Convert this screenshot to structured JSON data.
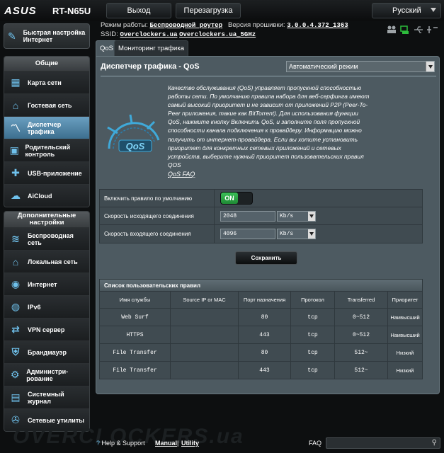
{
  "header": {
    "brand": "ASUS",
    "model": "RT-N65U",
    "logout": "Выход",
    "reboot": "Перезагрузка",
    "language": "Русский",
    "mode_label": "Режим работы:",
    "mode_value": "Беспроводной роутер",
    "fw_label": "Версия прошивки:",
    "fw_value": "3.0.0.4.372_1363",
    "ssid_label": "SSID:",
    "ssid_1": "Overclockers.ua",
    "ssid_2": "Overclockers.ua_5GHz"
  },
  "sidebar": {
    "quick_setup": "Быстрая настройка Интернет",
    "general_header": "Общие",
    "general": [
      {
        "label": "Карта сети",
        "icon": "network-map-icon"
      },
      {
        "label": "Гостевая сеть",
        "icon": "guest-network-icon"
      },
      {
        "label": "Диспетчер трафика",
        "icon": "traffic-manager-icon"
      },
      {
        "label": "Родительский контроль",
        "icon": "parental-control-icon"
      },
      {
        "label": "USB-приложение",
        "icon": "usb-app-icon"
      },
      {
        "label": "AiCloud",
        "icon": "cloud-icon"
      }
    ],
    "advanced_header": "Дополнительные настройки",
    "advanced": [
      {
        "label": "Беспроводная сеть",
        "icon": "wifi-icon"
      },
      {
        "label": "Локальная сеть",
        "icon": "lan-icon"
      },
      {
        "label": "Интернет",
        "icon": "globe-icon"
      },
      {
        "label": "IPv6",
        "icon": "ipv6-icon"
      },
      {
        "label": "VPN сервер",
        "icon": "vpn-icon"
      },
      {
        "label": "Брандмауэр",
        "icon": "firewall-icon"
      },
      {
        "label": "Администри-рование",
        "icon": "admin-icon"
      },
      {
        "label": "Системный журнал",
        "icon": "log-icon"
      },
      {
        "label": "Сетевые утилиты",
        "icon": "tools-icon"
      }
    ]
  },
  "tabs": [
    "QoS",
    "Мониторинг трафика"
  ],
  "main": {
    "title": "Диспетчер трафика - QoS",
    "mode_select": "Автоматический режим",
    "gauge_text": "QoS",
    "description": "Качество обслуживания (QoS) управляет пропускной способностью работы сети. По умолчанию правила набора для веб-серфинга имеют самый высокий приоритет и не зависит от приложений P2P (Peer-To-Peer приложения, такие как BitTorrent). Для использования функции QoS, нажмите кнопку Включить QoS, и заполните поля пропускной способности канала подключения к провайдеру. Информацию можно получить от интернет-провайдера. Если вы хотите установить приоритет для конкретных сетевых приложений и сетевых устройств, выберите нужный приоритет пользовательских правил QOS",
    "faq_link": "QoS FAQ",
    "form": {
      "default_rule_label": "Включить правило по умолчанию",
      "toggle": "ON",
      "upload_label": "Скорость исходящего соединения",
      "upload_value": "2048",
      "upload_unit": "Kb/s",
      "download_label": "Скорость входящего соединения",
      "download_value": "4096",
      "download_unit": "Kb/s"
    },
    "save": "Сохранить",
    "table": {
      "caption": "Список пользовательских правил",
      "headers": [
        "Имя службы",
        "Source IP or MAC",
        "Порт назначения",
        "Протокол",
        "Transferred",
        "Приоритет"
      ],
      "rows": [
        [
          "Web Surf",
          "",
          "80",
          "tcp",
          "0~512",
          "Наивысший"
        ],
        [
          "HTTPS",
          "",
          "443",
          "tcp",
          "0~512",
          "Наивысший"
        ],
        [
          "File Transfer",
          "",
          "80",
          "tcp",
          "512~",
          "Низкий"
        ],
        [
          "File Transfer",
          "",
          "443",
          "tcp",
          "512~",
          "Низкий"
        ]
      ]
    }
  },
  "footer": {
    "help": "Help & Support",
    "manual": "Manual",
    "sep": "|",
    "utility": "Utility",
    "faq": "FAQ"
  }
}
